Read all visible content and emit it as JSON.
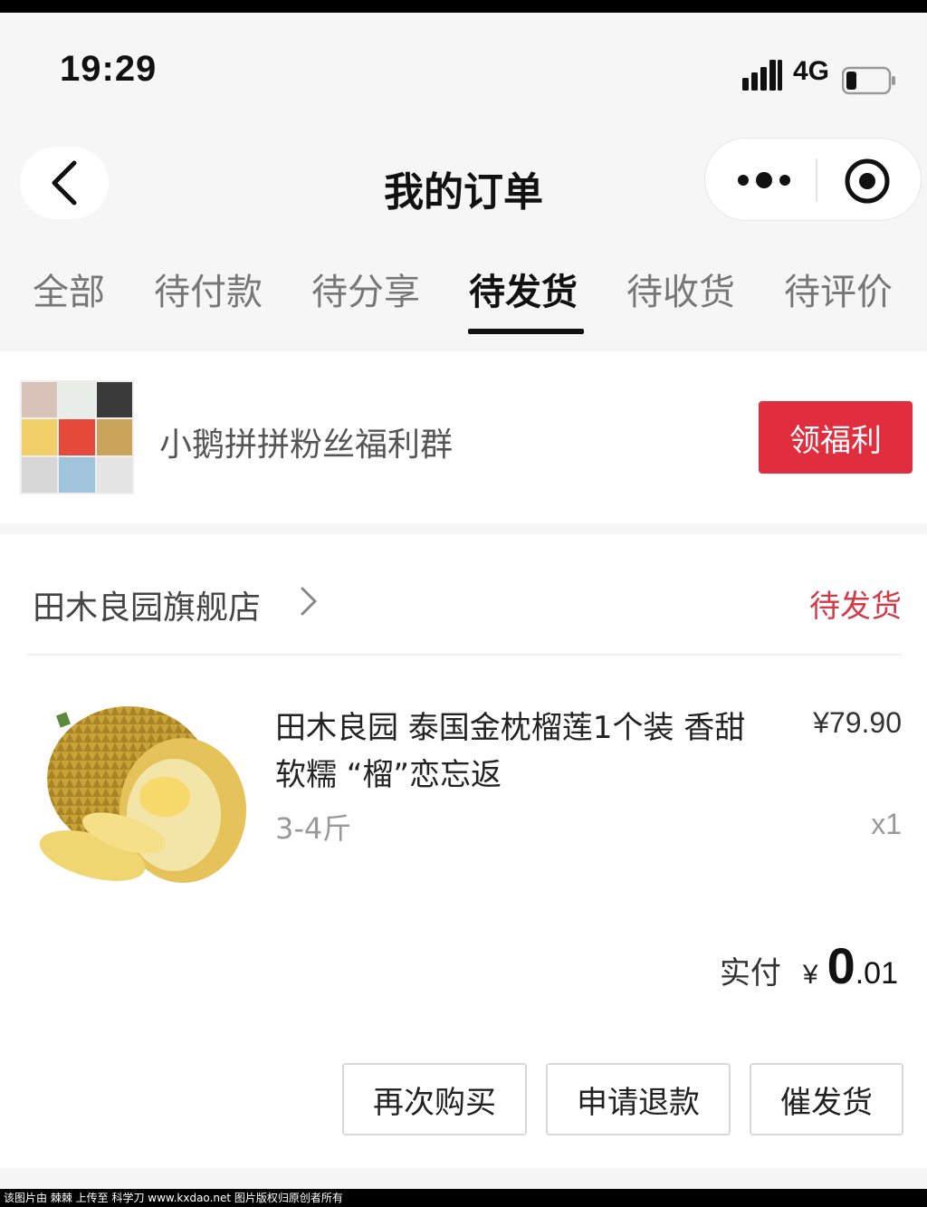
{
  "status_bar": {
    "time": "19:29",
    "network": "4G",
    "battery_level": 0.25
  },
  "navbar": {
    "title": "我的订单",
    "back_icon": "chevron-left-icon",
    "more_icon": "more-dots-icon",
    "close_icon": "target-circle-icon"
  },
  "tabs": [
    {
      "label": "全部",
      "active": false
    },
    {
      "label": "待付款",
      "active": false
    },
    {
      "label": "待分享",
      "active": false
    },
    {
      "label": "待发货",
      "active": true
    },
    {
      "label": "待收货",
      "active": false
    },
    {
      "label": "待评价",
      "active": false
    }
  ],
  "group": {
    "name": "小鹅拼拼粉丝福利群",
    "button_label": "领福利"
  },
  "order": {
    "shop_name": "田木良园旗舰店",
    "status": "待发货",
    "product": {
      "title": "田木良园 泰国金枕榴莲1个装 香甜软糯 “榴”恋忘返",
      "price": "¥79.90",
      "spec": "3-4斤",
      "quantity": "x1"
    },
    "paid": {
      "label": "实付",
      "currency": "¥",
      "integer": "0",
      "decimal": ".01"
    },
    "actions": {
      "rebuy": "再次购买",
      "refund": "申请退款",
      "urge": "催发货"
    }
  },
  "colors": {
    "accent_red": "#e02e3e",
    "status_red": "#d23a48",
    "background": "#f5f5f5"
  },
  "watermark": "该图片由 棘棘 上传至 科学刀 www.kxdao.net 图片版权归原创者所有"
}
